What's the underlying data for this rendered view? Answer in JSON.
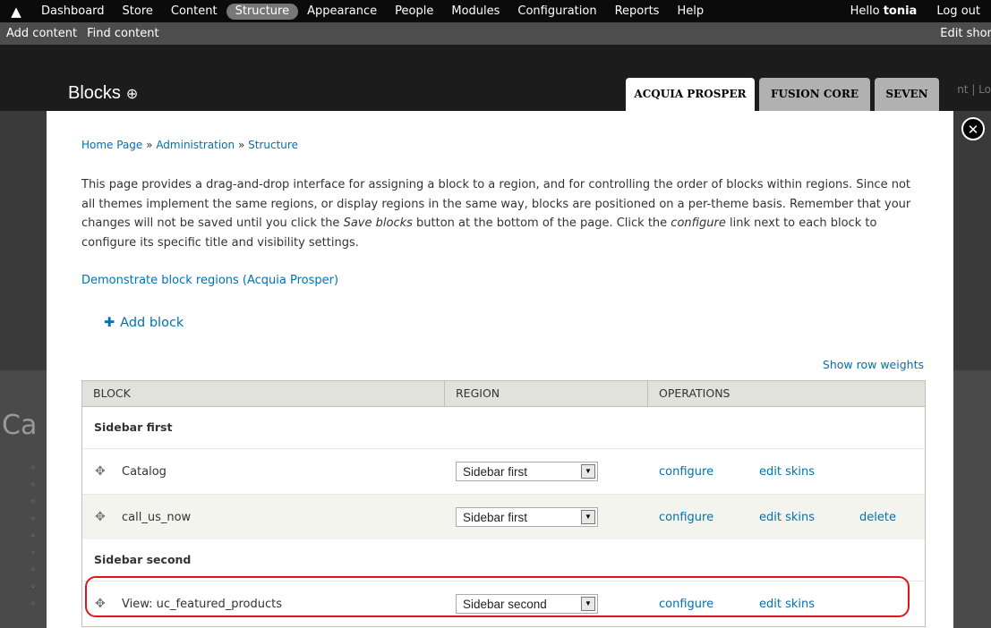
{
  "toolbar": {
    "items": [
      "Dashboard",
      "Store",
      "Content",
      "Structure",
      "Appearance",
      "People",
      "Modules",
      "Configuration",
      "Reports",
      "Help"
    ],
    "active": "Structure",
    "hello": "Hello",
    "user": "tonia",
    "logout": "Log out",
    "shortcuts": [
      "Add content",
      "Find content"
    ],
    "edit_shortcuts": "Edit short"
  },
  "page": {
    "title": "Blocks",
    "add_icon": "⊕",
    "ghost_nav": "nt | Lo"
  },
  "theme_tabs": [
    "ACQUIA PROSPER",
    "FUSION CORE",
    "SEVEN"
  ],
  "dialog": {
    "close": "✕",
    "breadcrumb": [
      "Home Page",
      "Administration",
      "Structure"
    ],
    "breadcrumb_sep": "»",
    "desc_parts": {
      "a": "This page provides a drag-and-drop interface for assigning a block to a region, and for controlling the order of blocks within regions. Since not all themes implement the same regions, or display regions in the same way, blocks are positioned on a per-theme basis. Remember that your changes will not be saved until you click the ",
      "b": "Save blocks",
      "c": " button at the bottom of the page. Click the ",
      "d": "configure",
      "e": " link next to each block to configure its specific title and visibility settings."
    },
    "demo_link": "Demonstrate block regions (Acquia Prosper)",
    "add_block": "Add block",
    "show_row_weights": "Show row weights"
  },
  "table": {
    "headers": [
      "BLOCK",
      "REGION",
      "OPERATIONS"
    ],
    "regions": [
      {
        "label": "Sidebar first",
        "rows": [
          {
            "name": "Catalog",
            "region": "Sidebar first",
            "configure": "configure",
            "skins": "edit skins",
            "delete": ""
          },
          {
            "name": "call_us_now",
            "region": "Sidebar first",
            "configure": "configure",
            "skins": "edit skins",
            "delete": "delete"
          }
        ]
      },
      {
        "label": "Sidebar second",
        "rows": [
          {
            "name": "View: uc_featured_products",
            "region": "Sidebar second",
            "configure": "configure",
            "skins": "edit skins",
            "delete": ""
          }
        ]
      }
    ]
  },
  "colors": {
    "link": "#0071b3",
    "highlight": "#e0161c"
  }
}
